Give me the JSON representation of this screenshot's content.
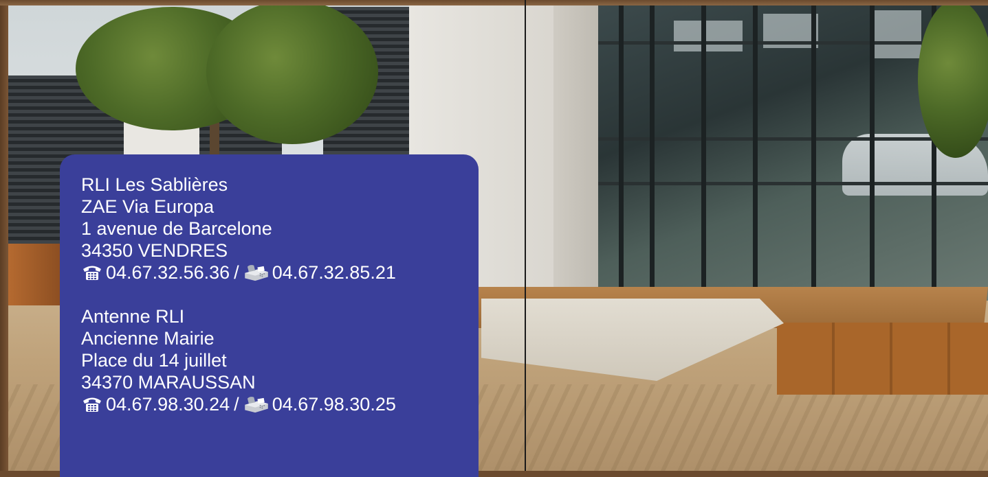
{
  "contacts": [
    {
      "name": "RLI Les Sablières",
      "address_lines": [
        "ZAE Via Europa",
        "1 avenue de Barcelone",
        "34350 VENDRES"
      ],
      "phone": "04.67.32.56.36",
      "separator": "/",
      "fax": "04.67.32.85.21"
    },
    {
      "name": "Antenne RLI",
      "address_lines": [
        "Ancienne Mairie",
        "Place du 14 juillet",
        "34370 MARAUSSAN"
      ],
      "phone": "04.67.98.30.24",
      "separator": "/",
      "fax": "04.67.98.30.25"
    }
  ],
  "icons": {
    "phone": "telephone-icon",
    "fax": "fax-machine-icon"
  },
  "colors": {
    "panel": "#3a3f9a",
    "text": "#ffffff"
  }
}
